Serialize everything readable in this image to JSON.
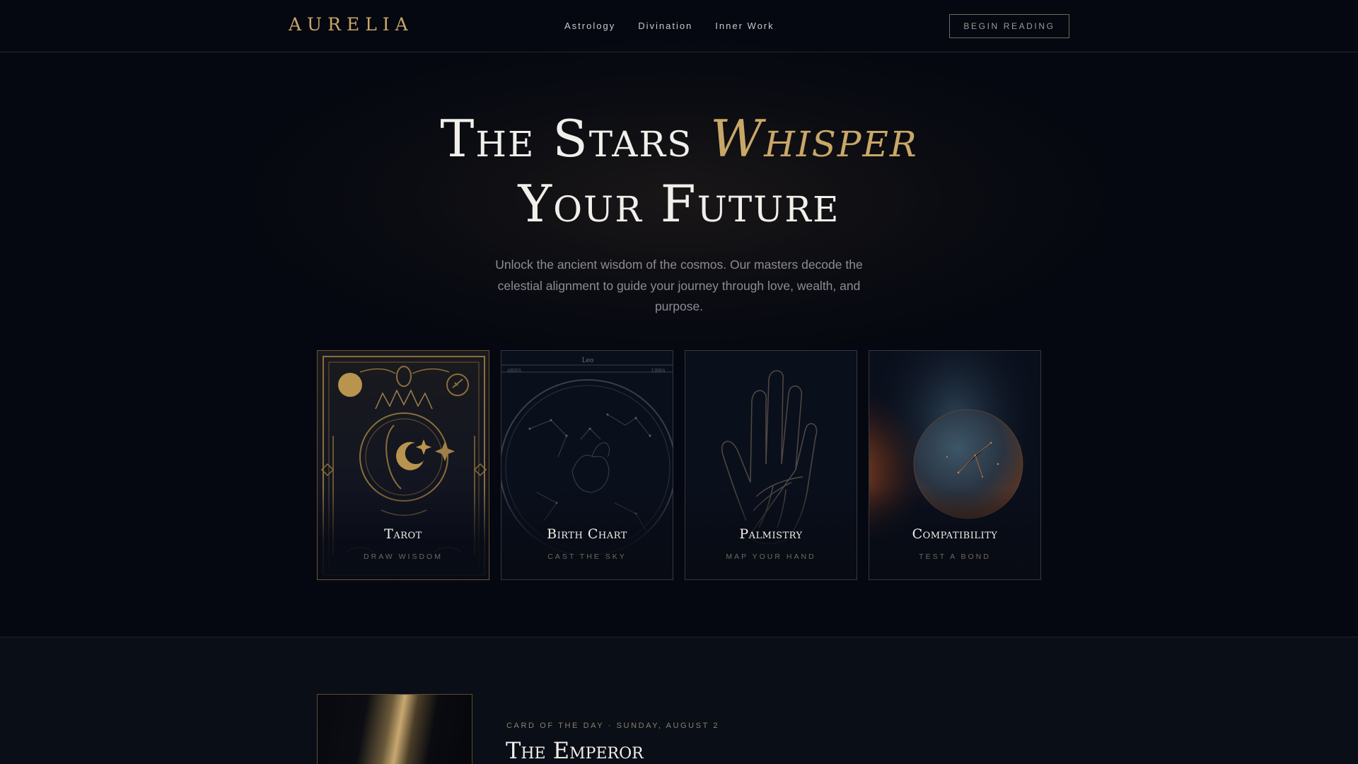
{
  "nav": {
    "logo": "AURELIA",
    "links": [
      "Astrology",
      "Divination",
      "Inner Work"
    ],
    "cta": "BEGIN READING"
  },
  "hero": {
    "title_line1_a": "The Stars ",
    "title_line1_accent": "Whisper",
    "title_line2": "Your Future",
    "subtitle": "Unlock the ancient wisdom of the cosmos. Our masters decode the celestial alignment to guide your journey through love, wealth, and purpose."
  },
  "cards": [
    {
      "title": "Tarot",
      "subtitle": "DRAW WISDOM"
    },
    {
      "title": "Birth Chart",
      "subtitle": "CAST THE SKY"
    },
    {
      "title": "Palmistry",
      "subtitle": "MAP YOUR HAND"
    },
    {
      "title": "Compatibility",
      "subtitle": "TEST A BOND"
    }
  ],
  "birth_chart_labels": {
    "top": "Leo",
    "left": "ARIES",
    "right": "LIBRA"
  },
  "card_of_the_day": {
    "label": "CARD OF THE DAY · SUNDAY, AUGUST 2",
    "title": "The Emperor"
  },
  "colors": {
    "background": "#050810",
    "accent_gold": "#c9a767",
    "text": "#f1efea",
    "muted": "#8b8d93"
  }
}
